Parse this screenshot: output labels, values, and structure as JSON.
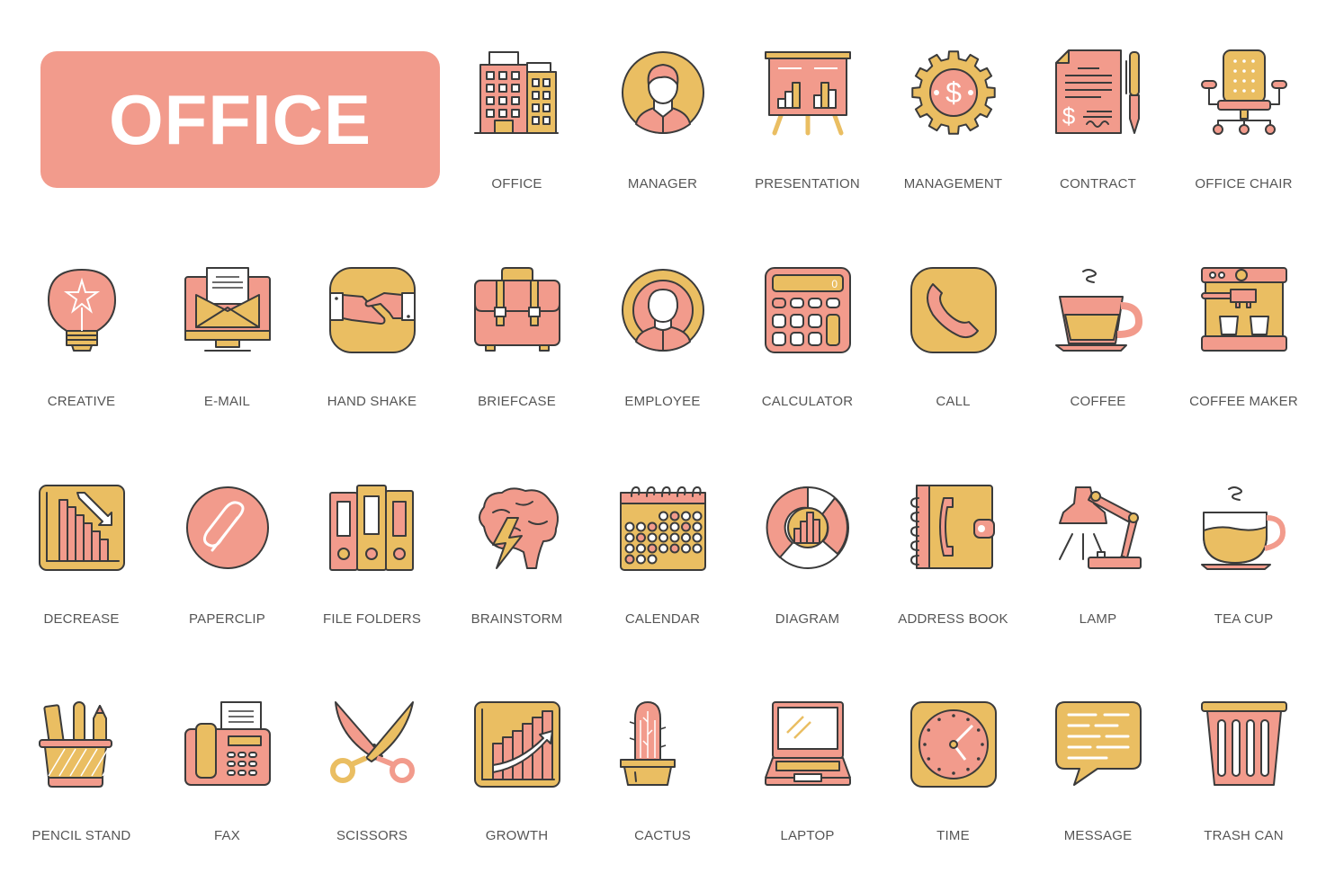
{
  "colors": {
    "pink": "#f29b8c",
    "yellow": "#eabe62",
    "outline": "#3b3b3b",
    "label": "#555555",
    "background": "#ffffff",
    "banner_text": "#ffffff"
  },
  "banner": {
    "title": "OFFICE"
  },
  "icons": [
    {
      "label": "OFFICE",
      "icon": "office-building-icon"
    },
    {
      "label": "MANAGER",
      "icon": "manager-avatar-icon"
    },
    {
      "label": "PRESENTATION",
      "icon": "presentation-board-icon"
    },
    {
      "label": "MANAGEMENT",
      "icon": "gear-dollar-icon"
    },
    {
      "label": "CONTRACT",
      "icon": "contract-pen-icon"
    },
    {
      "label": "OFFICE CHAIR",
      "icon": "office-chair-icon"
    },
    {
      "label": "CREATIVE",
      "icon": "lightbulb-star-icon"
    },
    {
      "label": "E-MAIL",
      "icon": "email-monitor-icon"
    },
    {
      "label": "HAND SHAKE",
      "icon": "handshake-icon"
    },
    {
      "label": "BRIEFCASE",
      "icon": "briefcase-icon"
    },
    {
      "label": "EMPLOYEE",
      "icon": "employee-avatar-icon"
    },
    {
      "label": "CALCULATOR",
      "icon": "calculator-icon"
    },
    {
      "label": "CALL",
      "icon": "phone-handset-icon"
    },
    {
      "label": "COFFEE",
      "icon": "coffee-cup-icon"
    },
    {
      "label": "COFFEE MAKER",
      "icon": "coffee-maker-icon"
    },
    {
      "label": "DECREASE",
      "icon": "decrease-chart-icon"
    },
    {
      "label": "PAPERCLIP",
      "icon": "paperclip-icon"
    },
    {
      "label": "FILE FOLDERS",
      "icon": "file-folders-icon"
    },
    {
      "label": "BRAINSTORM",
      "icon": "brain-lightning-icon"
    },
    {
      "label": "CALENDAR",
      "icon": "calendar-icon"
    },
    {
      "label": "DIAGRAM",
      "icon": "donut-diagram-icon"
    },
    {
      "label": "ADDRESS BOOK",
      "icon": "address-book-icon"
    },
    {
      "label": "LAMP",
      "icon": "desk-lamp-icon"
    },
    {
      "label": "TEA CUP",
      "icon": "tea-cup-icon"
    },
    {
      "label": "PENCIL STAND",
      "icon": "pencil-stand-icon"
    },
    {
      "label": "FAX",
      "icon": "fax-machine-icon"
    },
    {
      "label": "SCISSORS",
      "icon": "scissors-icon"
    },
    {
      "label": "GROWTH",
      "icon": "growth-chart-icon"
    },
    {
      "label": "CACTUS",
      "icon": "cactus-icon"
    },
    {
      "label": "LAPTOP",
      "icon": "laptop-icon"
    },
    {
      "label": "TIME",
      "icon": "clock-icon"
    },
    {
      "label": "MESSAGE",
      "icon": "message-bubble-icon"
    },
    {
      "label": "TRASH CAN",
      "icon": "trash-can-icon"
    }
  ],
  "calculator_display": "0"
}
